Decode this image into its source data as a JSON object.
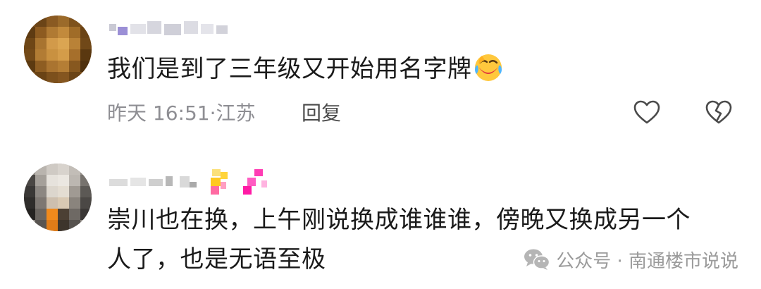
{
  "comments": [
    {
      "text": "我们是到了三年级又开始用名字牌",
      "emoji": "face-with-tears-of-joy-emoji",
      "time": "昨天 16:51",
      "location": "江苏",
      "reply_label": "回复"
    },
    {
      "text_line1": "崇川也在换，上午刚说换成谁谁谁，傍晚又换成另一个",
      "text_line2": "人了，也是无语至极"
    }
  ],
  "watermark": {
    "text": "公众号 · 南通楼市说说"
  },
  "colors": {
    "text": "#1a1a1a",
    "meta": "#8e8e93",
    "icon": "#4a4a4a"
  }
}
